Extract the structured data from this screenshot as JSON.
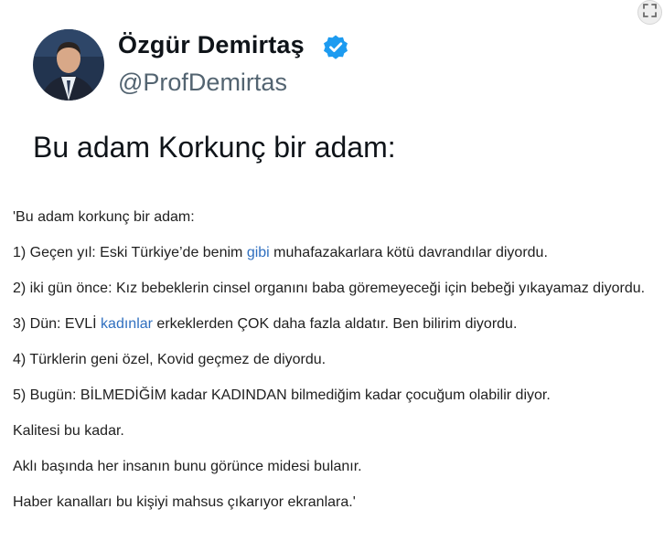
{
  "tweet": {
    "display_name": "Özgür Demirtaş",
    "handle": "@ProfDemirtas",
    "text": "Bu adam Korkunç bir adam:"
  },
  "quote": {
    "line1": "'Bu adam korkunç bir adam:",
    "line2_pre": "1) Geçen yıl: Eski Türkiye’de benim ",
    "line2_link": "gibi",
    "line2_post": " muhafazakarlara kötü davrandılar diyordu.",
    "line3": "2) iki gün önce: Kız bebeklerin cinsel organını baba göremeyeceği için bebeği yıkayamaz diyordu.",
    "line4_pre": "3) Dün: EVLİ ",
    "line4_link": "kadınlar",
    "line4_post": " erkeklerden ÇOK daha fazla aldatır. Ben bilirim diyordu.",
    "line5": "4) Türklerin geni özel, Kovid geçmez de diyordu.",
    "line6": "5) Bugün: BİLMEDİĞİM kadar KADINDAN bilmediğim kadar çocuğum olabilir diyor.",
    "line7": "Kalitesi bu kadar.",
    "line8": "Aklı başında her insanın bunu görünce midesi bulanır.",
    "line9": "Haber kanalları bu kişiyi mahsus çıkarıyor ekranlara.'"
  },
  "icons": {
    "verified": "verified-badge-icon",
    "expand": "expand-icon"
  },
  "colors": {
    "link": "#2f6fbf",
    "verified": "#1d9bf0",
    "handle": "#536471"
  }
}
